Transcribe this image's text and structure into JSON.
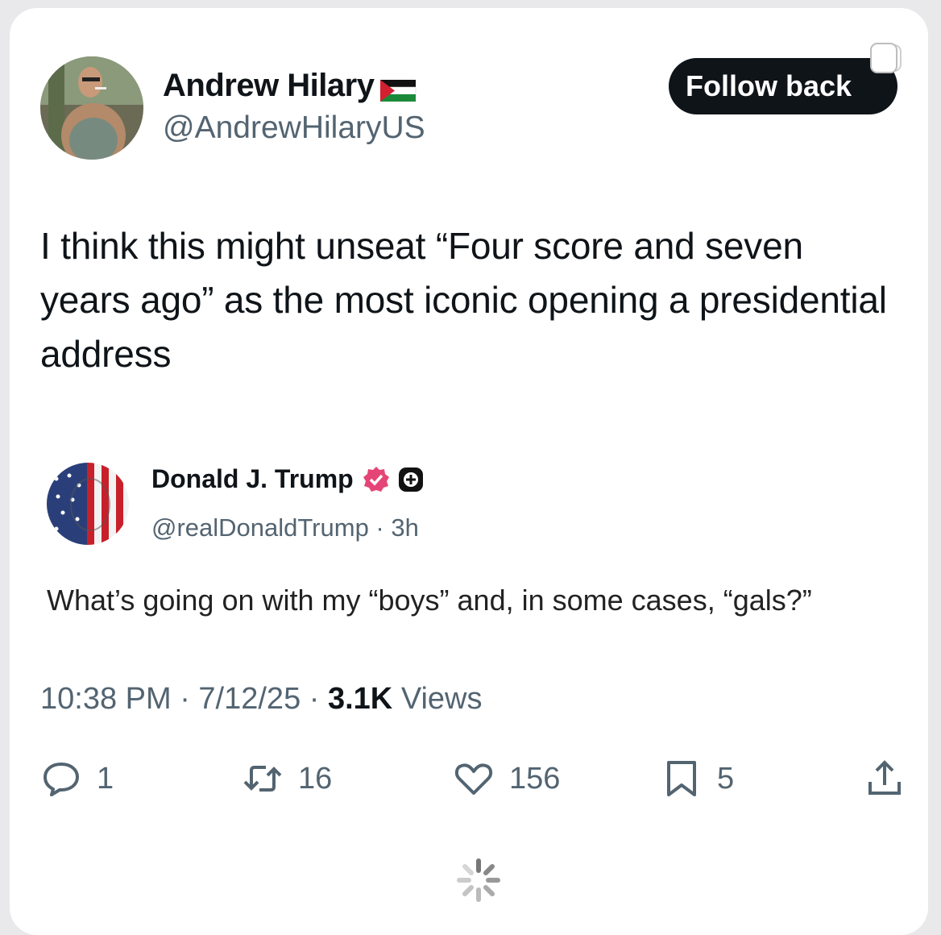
{
  "post": {
    "author_name": "Andrew Hilary",
    "author_handle": "@AndrewHilaryUS",
    "follow_button": "Follow back",
    "text": "I think this might unseat “Four score and seven years ago” as the most iconic opening a presidential address",
    "timestamp": "10:38 PM · 7/12/25 · ",
    "views_count": "3.1K",
    "views_label": " Views"
  },
  "quoted": {
    "author_name": "Donald J. Trump",
    "author_handle": "@realDonaldTrump · 3h",
    "text": "What’s going on with my “boys” and, in some cases, “gals?”"
  },
  "actions": {
    "replies": "1",
    "reposts": "16",
    "likes": "156",
    "bookmarks": "5"
  },
  "colors": {
    "text_primary": "#0f1419",
    "text_secondary": "#536471",
    "verified_badge": "#e0245e",
    "button_bg": "#0f1419"
  },
  "icons": [
    "reply-icon",
    "repost-icon",
    "like-icon",
    "bookmark-icon",
    "share-icon",
    "verified-badge-icon",
    "plus-badge-icon",
    "palestine-flag-icon",
    "loading-spinner-icon"
  ]
}
